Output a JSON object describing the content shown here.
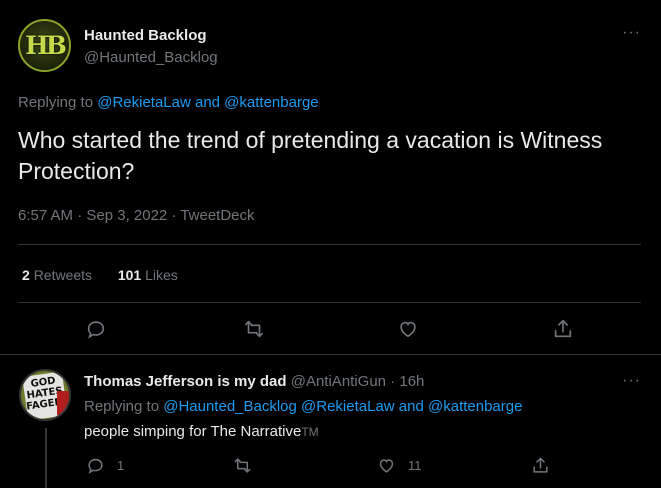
{
  "main_tweet": {
    "author_name": "Haunted Backlog",
    "author_handle": "@Haunted_Backlog",
    "avatar_text": "HB",
    "more": "···",
    "replying_prefix": "Replying to ",
    "replying_to": "@RekietaLaw and @kattenbarge",
    "text": "Who started the trend of pretending a vacation is Witness Protection?",
    "meta": "6:57 AM · Sep 3, 2022 · TweetDeck",
    "retweets_count": "2",
    "retweets_label": "Retweets",
    "likes_count": "101",
    "likes_label": "Likes"
  },
  "reply": {
    "author_name": "Thomas Jefferson is my dad",
    "author_handle": "@AntiAntiGun",
    "time": "· 16h",
    "more": "···",
    "avatar_text": "GOD HATES FAGENTS",
    "replying_prefix": "Replying to ",
    "replying_to": "@Haunted_Backlog @RekietaLaw and @kattenbarge",
    "text": "people simping for The Narrative",
    "tm": "TM",
    "reply_count": "1",
    "like_count": "11"
  },
  "colors": {
    "background": "#000000",
    "text": "#e7e9ea",
    "muted": "#71767b",
    "link": "#1d9bf0",
    "divider": "#2f3336"
  }
}
